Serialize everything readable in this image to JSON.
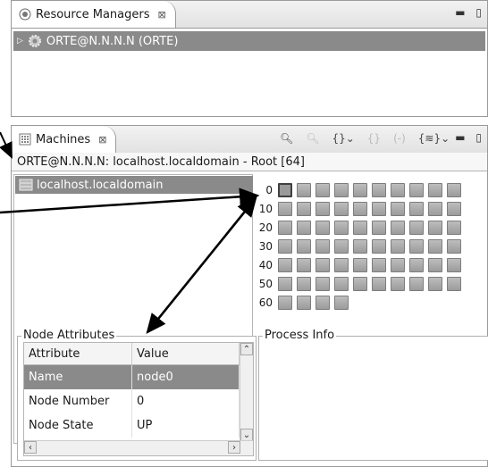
{
  "resource_managers": {
    "tab_label": "Resource Managers",
    "tab_close": "⊠",
    "items": [
      {
        "label": "ORTE@N.N.N.N (ORTE)"
      }
    ]
  },
  "machines": {
    "tab_label": "Machines",
    "tab_close": "⊠",
    "path": "ORTE@N.N.N.N: localhost.localdomain - Root [64]",
    "machine_items": [
      {
        "label": "localhost.localdomain"
      }
    ],
    "row_labels": [
      "0",
      "10",
      "20",
      "30",
      "40",
      "50",
      "60"
    ],
    "node_count": 64,
    "selected_node": 0
  },
  "node_attributes": {
    "group_label": "Node Attributes",
    "columns": [
      "Attribute",
      "Value"
    ],
    "rows": [
      {
        "attribute": "Name",
        "value": "node0",
        "selected": true
      },
      {
        "attribute": "Node Number",
        "value": "0"
      },
      {
        "attribute": "Node State",
        "value": "UP"
      }
    ]
  },
  "process_info": {
    "group_label": "Process Info"
  },
  "icons": {
    "view_menu": "view-menu-icon",
    "minimize": "minimize-icon",
    "maximize": "maximize-icon"
  },
  "colors": {
    "selection": "#8a8a8a",
    "node_fill": "#a8a8a8",
    "arrow": "#000000"
  }
}
